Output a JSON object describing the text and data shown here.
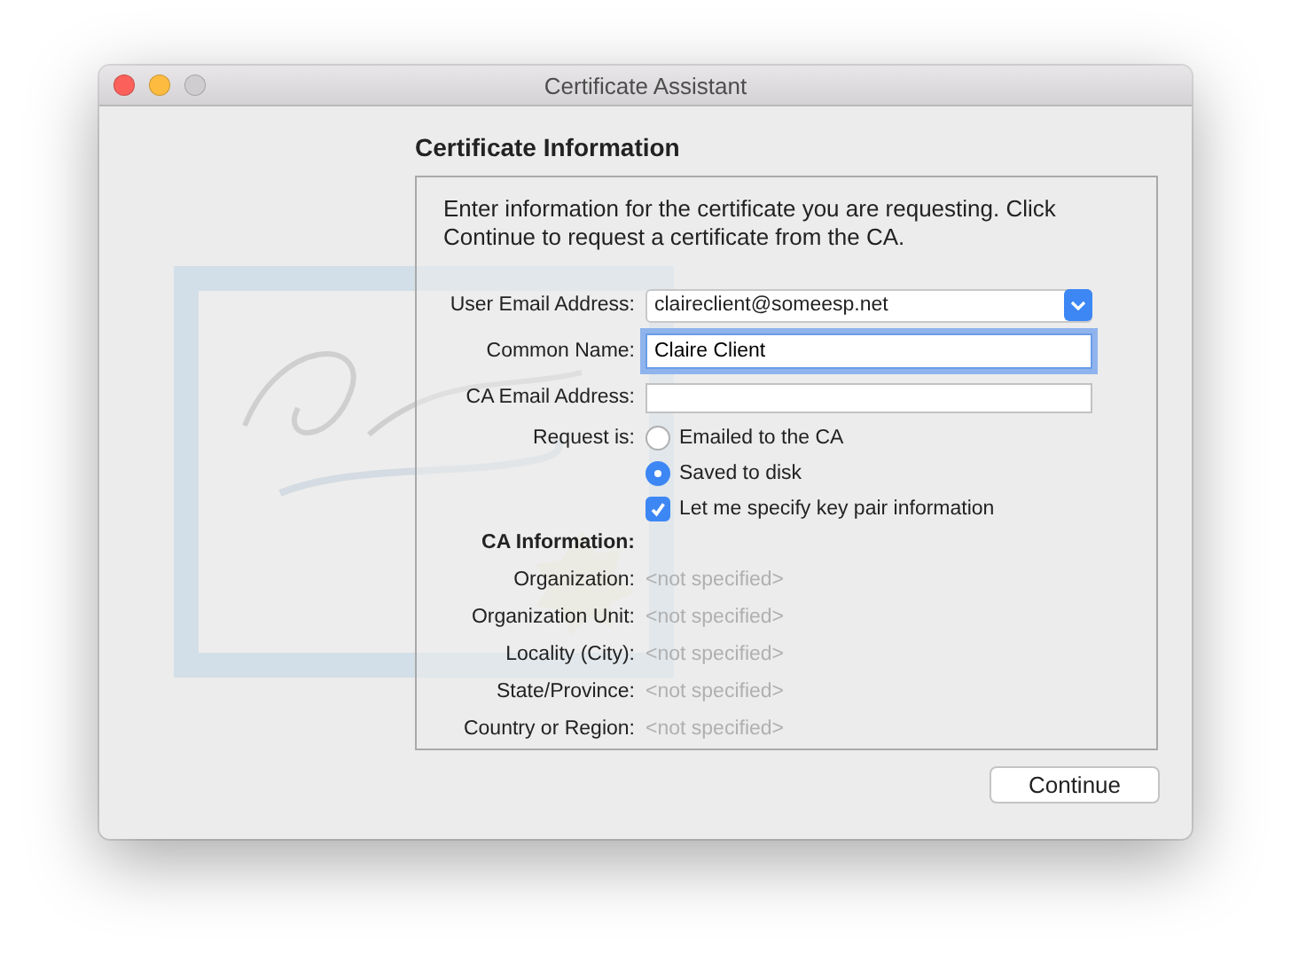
{
  "window": {
    "title": "Certificate Assistant",
    "controls": [
      {
        "kind": "close",
        "disabled": false
      },
      {
        "kind": "minimize",
        "disabled": false
      },
      {
        "kind": "zoom",
        "disabled": true
      }
    ]
  },
  "heading": "Certificate Information",
  "intro": "Enter information for the certificate you are requesting. Click Continue to request a certificate from the CA.",
  "fields": [
    {
      "label": "User Email Address:",
      "kind": "popup",
      "value": "claireclient@someesp.net"
    },
    {
      "label": "Common Name:",
      "kind": "text",
      "value": "Claire Client",
      "focused": true
    },
    {
      "label": "CA Email Address:",
      "kind": "text",
      "focused": false
    }
  ],
  "request": {
    "label": "Request is:",
    "options": [
      {
        "label": "Emailed to the CA",
        "selected": false
      },
      {
        "label": "Saved to disk",
        "selected": true
      }
    ]
  },
  "key_pair": {
    "label": "Let me specify key pair information",
    "checked": true
  },
  "ca_info": {
    "heading": "CA Information:",
    "rows": [
      {
        "label": "Organization:",
        "value": "<not specified>"
      },
      {
        "label": "Organization Unit:",
        "value": "<not specified>"
      },
      {
        "label": "Locality (City):",
        "value": "<not specified>"
      },
      {
        "label": "State/Province:",
        "value": "<not specified>"
      },
      {
        "label": "Country or Region:",
        "value": "<not specified>"
      }
    ]
  },
  "continue_button": {
    "label": "Continue"
  }
}
